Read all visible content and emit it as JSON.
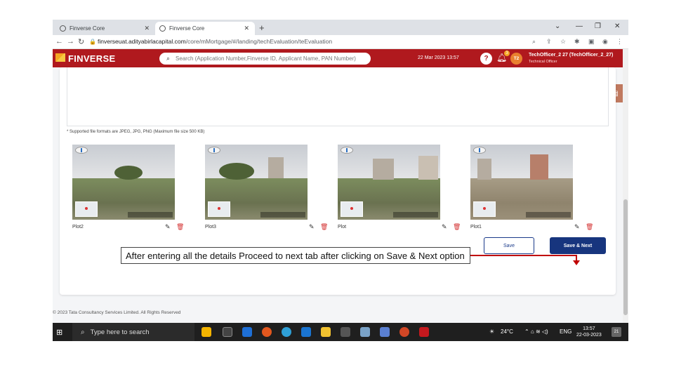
{
  "browser": {
    "tabs": [
      {
        "label": "Finverse Core"
      },
      {
        "label": "Finverse Core"
      }
    ],
    "url_domain": "finverseuat.adityabirlacapital.com",
    "url_path": "/core/mMortgage/#/landing/techEvaluation/teEvaluation"
  },
  "header": {
    "brand": "FINVERSE",
    "search_placeholder": "Search (Application Number,Finverse ID, Applicant Name, PAN Number)",
    "date": "22 Mar 2023 13:57",
    "notifications_count": "3",
    "avatar_initials": "T2",
    "user_name": "TechOfficer_2 27 (TechOfficer_2_27)",
    "user_role": "Technical Officer",
    "brand_color": "#b0191e"
  },
  "upload": {
    "supported_note": "* Supported file formats are JPEG, JPG, PNG (Maximum file size 500 KB)"
  },
  "photos": [
    {
      "label": "Plot2"
    },
    {
      "label": "Plot3"
    },
    {
      "label": "Plot"
    },
    {
      "label": "Plot1"
    }
  ],
  "actions": {
    "save_label": "Save",
    "save_next_label": "Save & Next"
  },
  "footer": {
    "text": "© 2023 Tata Consultancy Services Limited. All Rights Reserved"
  },
  "annotation": {
    "text": "After entering all the details Proceed to next tab after clicking on Save & Next option"
  },
  "taskbar": {
    "search_placeholder": "Type here to search",
    "weather": "24°C",
    "language": "ENG",
    "time": "13:57",
    "date": "22-03-2023",
    "notif_count": "21"
  }
}
